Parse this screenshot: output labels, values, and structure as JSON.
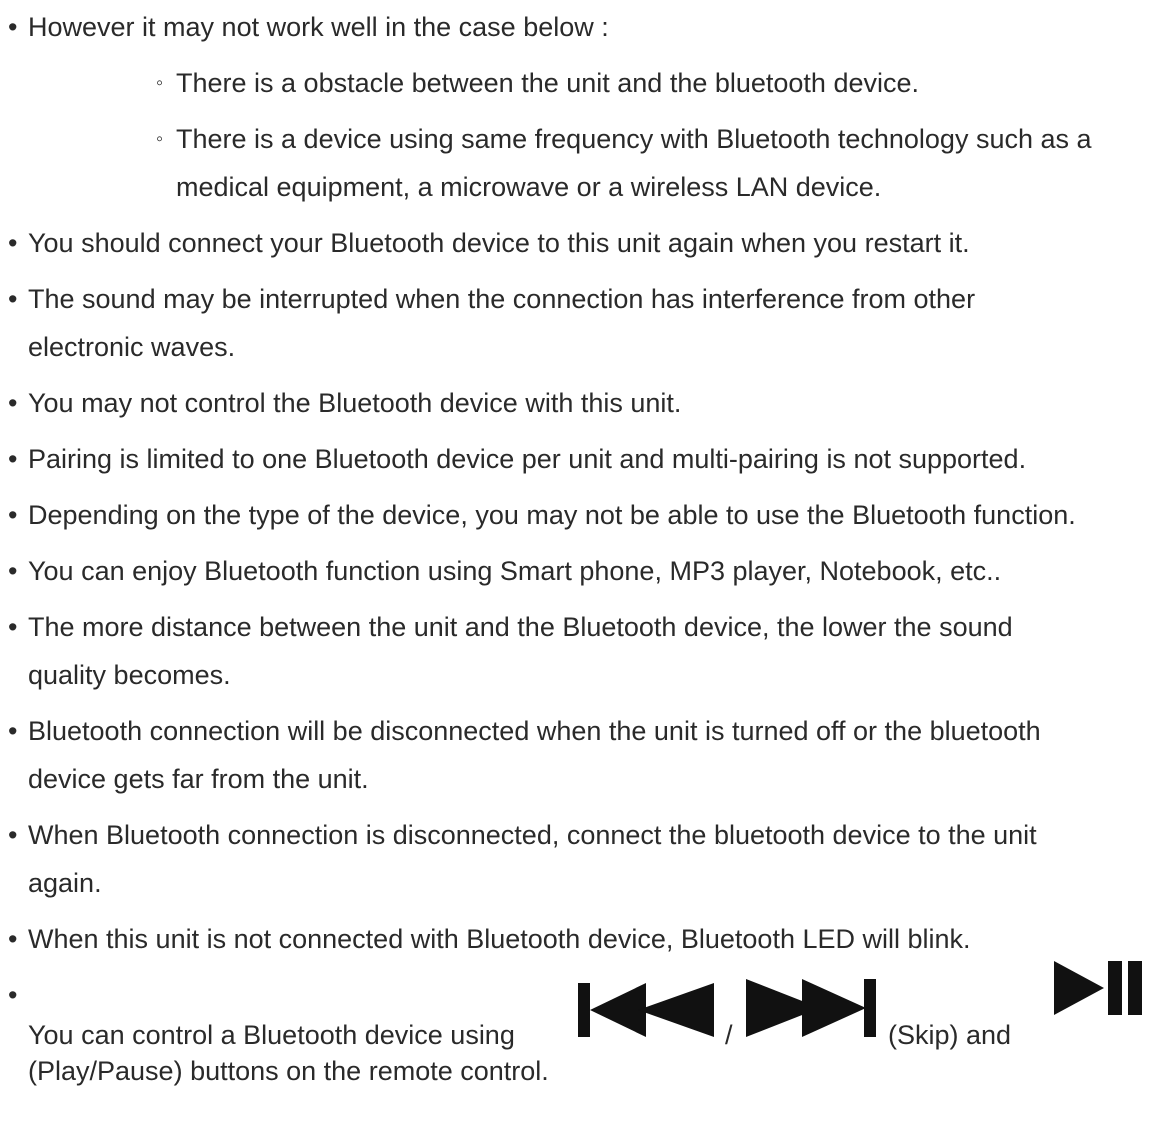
{
  "bullets": {
    "intro": "However it may not work well in the case below :",
    "sub1": "There is a obstacle between the unit and the bluetooth device.",
    "sub2_line1": "There is a device using same frequency with Bluetooth technology such as a",
    "sub2_line2": "medical equipment, a microwave or a wireless LAN device.",
    "b1": "You should connect your Bluetooth device to this unit again when you restart it.",
    "b2_line1": "The sound may be interrupted when the connection has interference from other",
    "b2_line2": "electronic waves.",
    "b3": "You may not control the Bluetooth device with this unit.",
    "b4": "Pairing is limited to one Bluetooth device per unit and multi-pairing is not supported.",
    "b5": "Depending on the type of the device, you may not be able to use the Bluetooth function.",
    "b6": "You can enjoy Bluetooth function using Smart phone, MP3 player, Notebook, etc..",
    "b7_line1": "The more distance between the unit and the Bluetooth device, the lower the sound",
    "b7_line2": "quality becomes.",
    "b8_line1": "Bluetooth connection will be disconnected when the unit is turned off or the bluetooth",
    "b8_line2": "device gets far from the unit.",
    "b9_line1": "When Bluetooth connection is disconnected, connect the bluetooth device to the unit",
    "b9_line2": "again.",
    "b10": "When this unit is not connected with Bluetooth device, Bluetooth LED will blink."
  },
  "control": {
    "prefix": "You can control a Bluetooth device using",
    "separator": "/",
    "skip_label": "(Skip) and",
    "line2": "(Play/Pause) buttons on the remote control.",
    "icons": [
      "skip-previous-icon",
      "skip-next-icon",
      "play-pause-icon"
    ]
  },
  "colors": {
    "text": "#2a2a2a",
    "icon": "#111111"
  }
}
